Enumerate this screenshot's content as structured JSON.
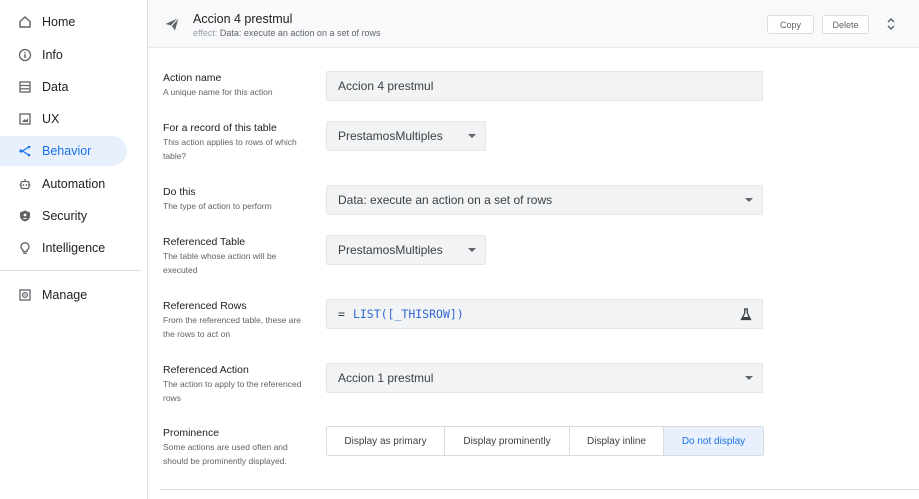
{
  "sidebar": {
    "items": [
      {
        "label": "Home",
        "icon": "home-icon"
      },
      {
        "label": "Info",
        "icon": "info-icon"
      },
      {
        "label": "Data",
        "icon": "data-icon"
      },
      {
        "label": "UX",
        "icon": "ux-icon"
      },
      {
        "label": "Behavior",
        "icon": "behavior-icon",
        "active": true
      },
      {
        "label": "Automation",
        "icon": "automation-icon"
      },
      {
        "label": "Security",
        "icon": "shield-icon"
      },
      {
        "label": "Intelligence",
        "icon": "lightbulb-icon"
      },
      {
        "label": "Manage",
        "icon": "manage-icon"
      }
    ]
  },
  "header": {
    "title": "Accion 4 prestmul",
    "effect_key": "effect:",
    "effect_value": "Data: execute an action on a set of rows",
    "copy_label": "Copy",
    "delete_label": "Delete"
  },
  "form": {
    "action_name": {
      "title": "Action name",
      "desc": "A unique name for this action",
      "value": "Accion 4 prestmul"
    },
    "table": {
      "title": "For a record of this table",
      "desc": "This action applies to rows of which table?",
      "value": "PrestamosMultiples"
    },
    "do_this": {
      "title": "Do this",
      "desc": "The type of action to perform",
      "value": "Data: execute an action on a set of rows"
    },
    "referenced_table": {
      "title": "Referenced Table",
      "desc": "The table whose action will be executed",
      "value": "PrestamosMultiples"
    },
    "referenced_rows": {
      "title": "Referenced Rows",
      "desc": "From the referenced table, these are the rows to act on",
      "eq": "=",
      "value": "LIST([_THISROW])"
    },
    "referenced_action": {
      "title": "Referenced Action",
      "desc": "The action to apply to the referenced rows",
      "value": "Accion 1 prestmul"
    },
    "prominence": {
      "title": "Prominence",
      "desc": "Some actions are used often and should be prominently displayed.",
      "options": [
        "Display as primary",
        "Display prominently",
        "Display inline",
        "Do not display"
      ],
      "selected": "Do not display"
    }
  },
  "colors": {
    "accent": "#1a73e8",
    "active_bg": "#e8f0fe",
    "expression": "#3367d6"
  }
}
